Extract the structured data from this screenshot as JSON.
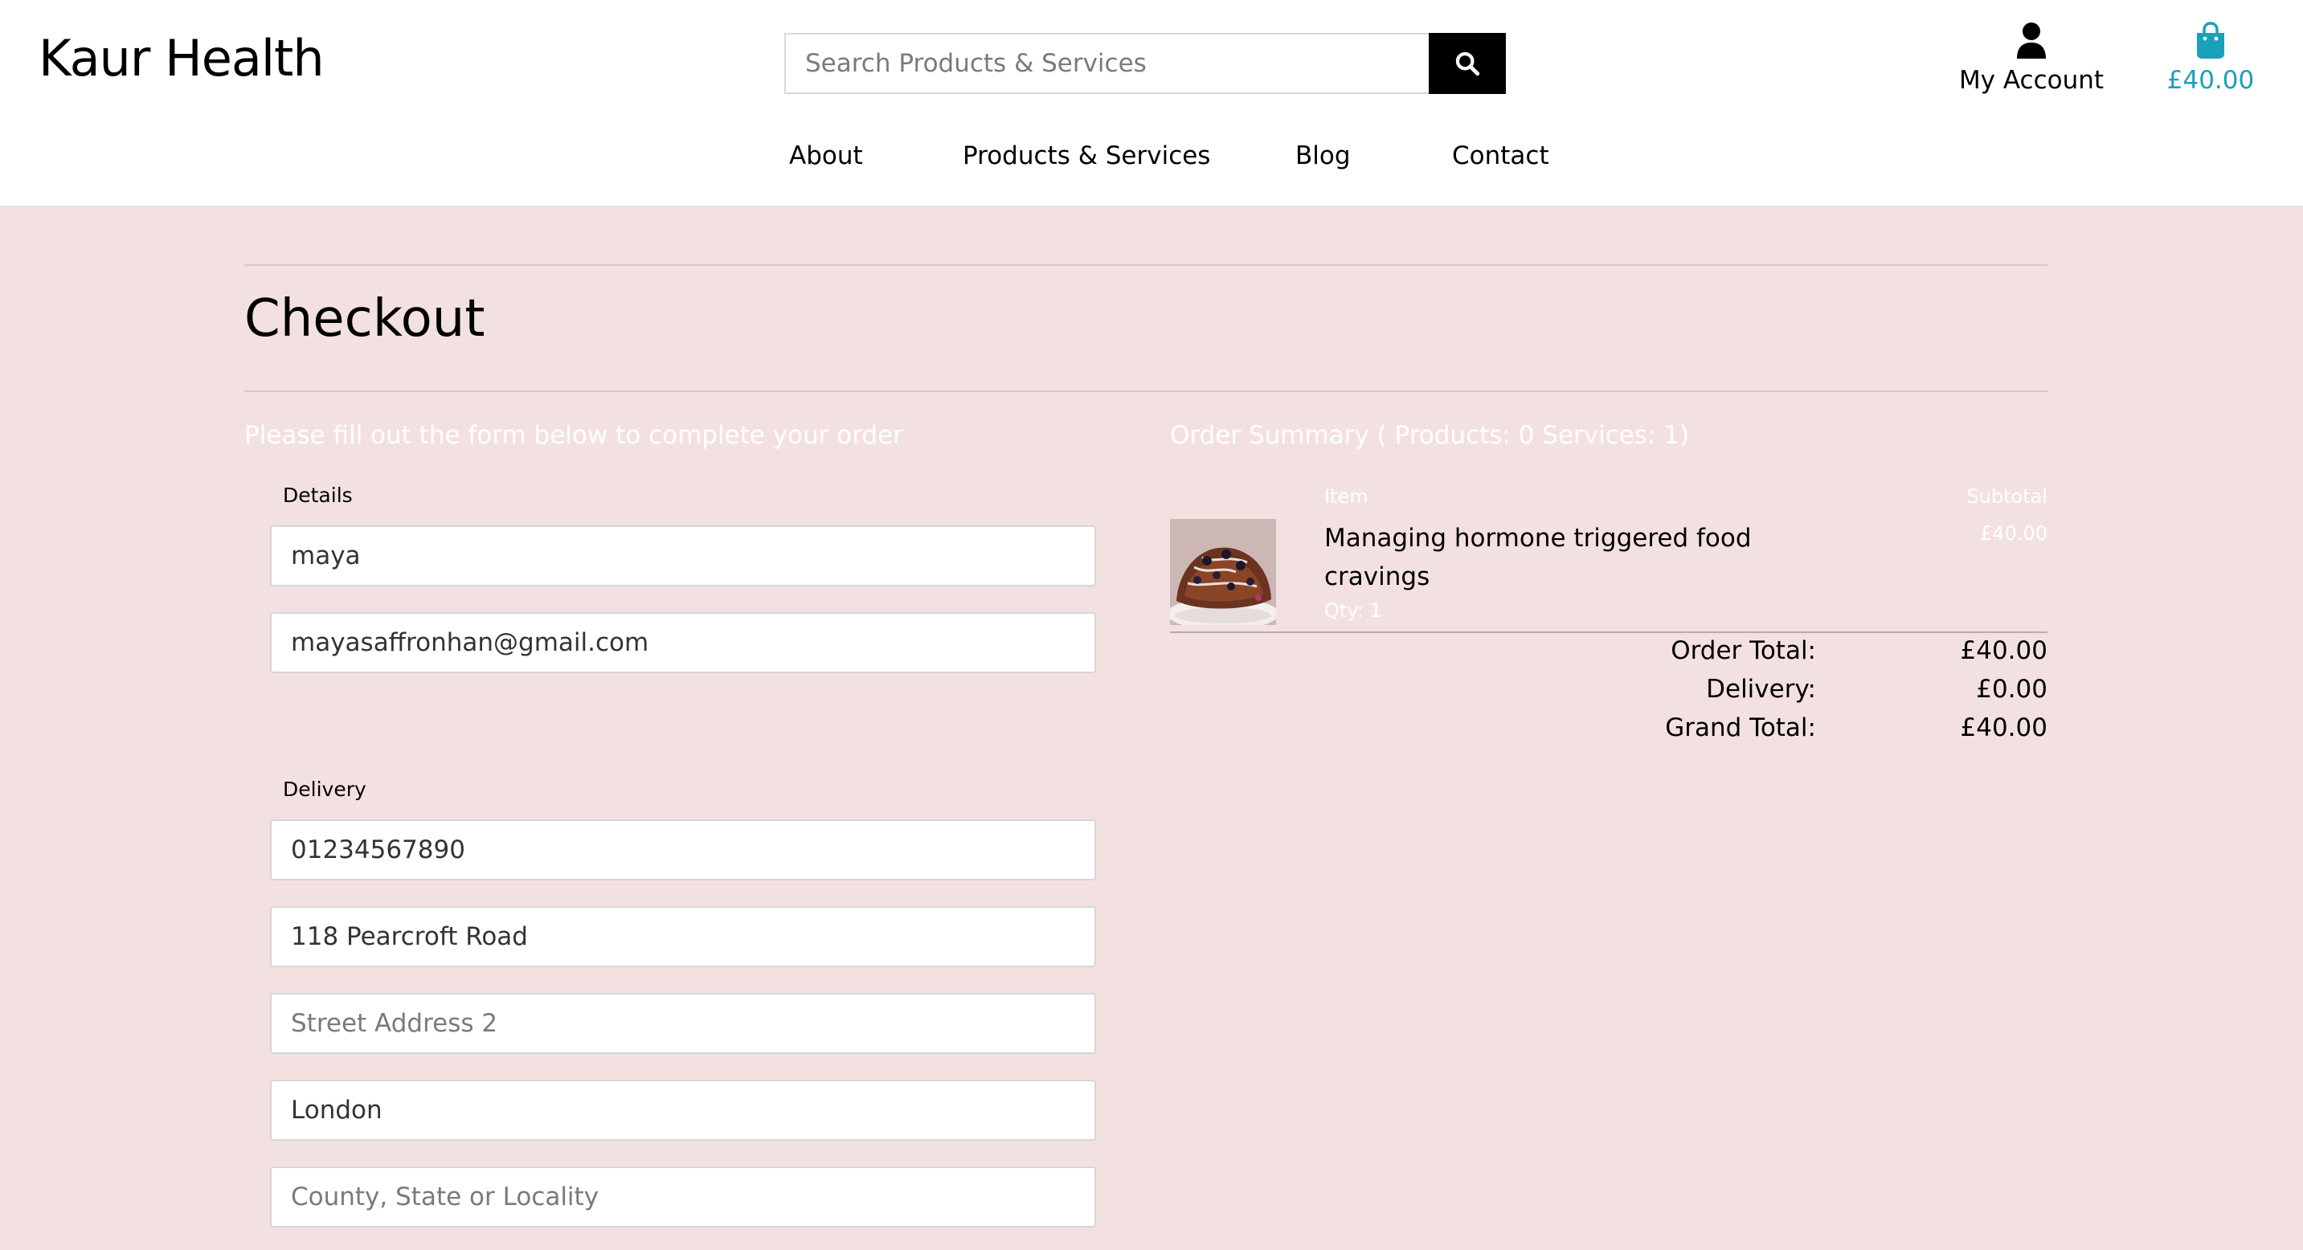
{
  "header": {
    "logo_part1": "Kaur",
    "logo_part2": " Health",
    "search_placeholder": "Search Products & Services",
    "search_button_icon": "search-icon",
    "account_icon": "user-icon",
    "account_label": "My Account",
    "cart_icon": "shopping-bag-icon",
    "cart_total": "£40.00",
    "cart_color": "#1aa0b8"
  },
  "nav": {
    "items": [
      {
        "label": "About"
      },
      {
        "label": "Products & Services"
      },
      {
        "label": "Blog"
      },
      {
        "label": "Contact"
      }
    ]
  },
  "checkout": {
    "title": "Checkout",
    "intro": "Please fill out the form below to complete your order",
    "details_legend": "Details",
    "full_name": "maya",
    "email": "mayasaffronhan@gmail.com",
    "delivery_legend": "Delivery",
    "phone": "01234567890",
    "street1": "118 Pearcroft Road",
    "street2_placeholder": "Street Address 2",
    "town": "London",
    "county_placeholder": "County, State or Locality"
  },
  "summary": {
    "title": "Order Summary ( Products: 0 Services: 1)",
    "col_item": "Item",
    "col_subtotal": "Subtotal",
    "items": [
      {
        "name": "Managing hormone triggered food cravings",
        "qty": "Qty: 1",
        "subtotal": "£40.00"
      }
    ],
    "order_total_label": "Order Total:",
    "order_total": "£40.00",
    "delivery_label": "Delivery:",
    "delivery": "£0.00",
    "grand_total_label": "Grand Total:",
    "grand_total": "£40.00"
  },
  "colors": {
    "page_background": "#f3e1e2",
    "accent": "#1aa0b8"
  }
}
